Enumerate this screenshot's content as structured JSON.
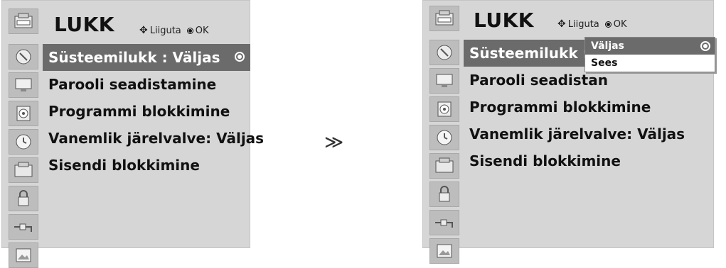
{
  "left": {
    "title": "LUKK",
    "hint_move": "Liiguta",
    "hint_ok": "OK",
    "items": [
      {
        "label": "Süsteemilukk    : Väljas"
      },
      {
        "label": "Parooli seadistamine"
      },
      {
        "label": "Programmi blokkimine"
      },
      {
        "label": "Vanemlik järelvalve: Väljas"
      },
      {
        "label": "Sisendi blokkimine"
      }
    ],
    "icons": [
      "satellite-icon",
      "monitor-icon",
      "speaker-icon",
      "clock-icon",
      "lock-menu-icon",
      "padlock-icon",
      "input-plug-icon",
      "photo-icon"
    ]
  },
  "arrow": "≫",
  "right": {
    "title": "LUKK",
    "hint_move": "Liiguta",
    "hint_ok": "OK",
    "items": [
      {
        "label": "Süsteemilukk    :"
      },
      {
        "label": "Parooli seadistan"
      },
      {
        "label": "Programmi blokkimine"
      },
      {
        "label": "Vanemlik järelvalve: Väljas"
      },
      {
        "label": "Sisendi blokkimine"
      }
    ],
    "dropdown": {
      "options": [
        "Väljas",
        "Sees"
      ],
      "selected": "Väljas"
    },
    "icons": [
      "satellite-icon",
      "monitor-icon",
      "speaker-icon",
      "clock-icon",
      "lock-menu-icon",
      "padlock-icon",
      "input-plug-icon",
      "photo-icon"
    ]
  }
}
